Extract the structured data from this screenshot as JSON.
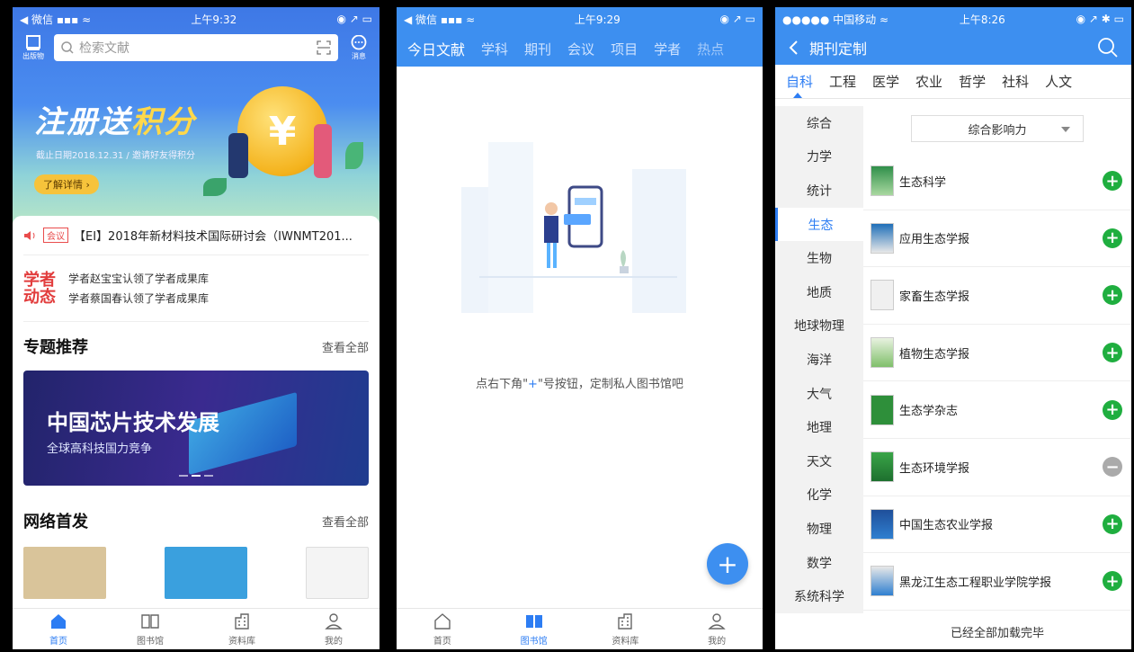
{
  "p1": {
    "status": {
      "left": "◀ 微信 ▪▪▪ ≈",
      "time": "上午9:32",
      "right": "◉ ↗ ▭"
    },
    "publisher_label": "出版物",
    "search_placeholder": "检索文献",
    "message_label": "消息",
    "banner": {
      "title_a": "注册送",
      "title_b": "积分",
      "sub": "截止日期2018.12.31 / 邀请好友得积分",
      "btn": "了解详情 ›",
      "coin": "¥"
    },
    "notice": {
      "tag": "会议",
      "text": "【EI】2018年新材料技术国际研讨会（IWNMT201..."
    },
    "scholar": {
      "logo_a": "学者",
      "logo_b": "动态",
      "line1": "学者赵宝宝认领了学者成果库",
      "line2": "学者蔡国春认领了学者成果库"
    },
    "topic": {
      "title": "专题推荐",
      "more": "查看全部",
      "banner_title": "中国芯片技术发展",
      "banner_sub": "全球高科技国力竞争"
    },
    "net": {
      "title": "网络首发",
      "more": "查看全部"
    },
    "tabs": [
      "首页",
      "图书馆",
      "资料库",
      "我的"
    ]
  },
  "p2": {
    "status": {
      "left": "◀ 微信 ▪▪▪ ≈",
      "time": "上午9:29",
      "right": "◉ ↗ ▭"
    },
    "nav": [
      "今日文献",
      "学科",
      "期刊",
      "会议",
      "项目",
      "学者",
      "热点"
    ],
    "empty_a": "点右下角\"",
    "empty_plus": "+",
    "empty_b": "\"号按钮，定制私人图书馆吧",
    "fab": "+",
    "tabs": [
      "首页",
      "图书馆",
      "资料库",
      "我的"
    ]
  },
  "p3": {
    "status": {
      "left": "●●●●● 中国移动 ≈",
      "time": "上午8:26",
      "right": "◉ ↗ ✱ ▭"
    },
    "title": "期刊定制",
    "cats": [
      "自科",
      "工程",
      "医学",
      "农业",
      "哲学",
      "社科",
      "人文"
    ],
    "side": [
      "综合",
      "力学",
      "统计",
      "生态",
      "生物",
      "地质",
      "地球物理",
      "海洋",
      "大气",
      "地理",
      "天文",
      "化学",
      "物理",
      "数学",
      "系统科学"
    ],
    "sort": "综合影响力",
    "journals": [
      {
        "name": "生态科学",
        "state": "+"
      },
      {
        "name": "应用生态学报",
        "state": "+"
      },
      {
        "name": "家畜生态学报",
        "state": "+"
      },
      {
        "name": "植物生态学报",
        "state": "+"
      },
      {
        "name": "生态学杂志",
        "state": "+"
      },
      {
        "name": "生态环境学报",
        "state": "−"
      },
      {
        "name": "中国生态农业学报",
        "state": "+"
      },
      {
        "name": "黑龙江生态工程职业学院学报",
        "state": "+"
      }
    ],
    "loaded": "已经全部加载完毕"
  }
}
